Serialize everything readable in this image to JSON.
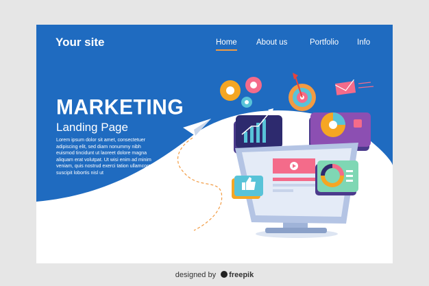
{
  "header": {
    "brand": "Your site",
    "nav": [
      {
        "label": "Home",
        "active": true
      },
      {
        "label": "About us",
        "active": false
      },
      {
        "label": "Portfolio",
        "active": false
      },
      {
        "label": "Info",
        "active": false
      }
    ]
  },
  "hero": {
    "title": "MARKETING",
    "subtitle": "Landing Page",
    "body": "Lorem ipsum dolor sit amet, consectetuer adipiscing elit, sed diam nonummy nibh euismod tincidunt ut laoreet dolore magna aliquam erat volutpat. Ut wisi enim ad minim veniam, quis nostrud exerci tation ullamcorper suscipit lobortis nisl ut"
  },
  "credit": {
    "prefix": "designed by",
    "brand": "freepik"
  },
  "colors": {
    "primary_blue": "#1f6bc0",
    "accent_orange": "#f29b42",
    "monitor_purple": "#4b3a8c",
    "card_pink": "#f46b8a",
    "card_green": "#7fd7b4"
  },
  "icons": [
    "paper-plane-icon",
    "gear-icon",
    "target-icon",
    "envelope-icon",
    "pie-chart-icon",
    "bar-chart-icon",
    "thumbs-up-icon",
    "donut-chart-icon",
    "play-icon"
  ]
}
